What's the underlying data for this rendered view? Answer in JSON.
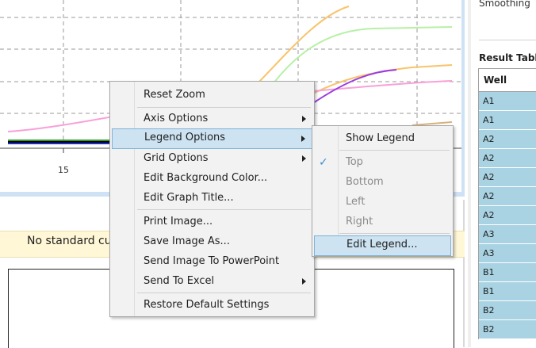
{
  "chart": {
    "x_tick_label": "15",
    "series_colors": [
      "#f9c36a",
      "#b7f0a6",
      "#9b3be0",
      "#f8a0d8",
      "#000000",
      "#1a2bd6",
      "#2aa02a",
      "#d9b07a"
    ]
  },
  "lower_panel": {
    "message": "No standard cu"
  },
  "right_pane": {
    "smoothing_label": "Smoothing",
    "result_table_title": "Result Table",
    "table_header": "Well",
    "rows": [
      "A1",
      "A1",
      "A2",
      "A2",
      "A2",
      "A2",
      "A2",
      "A3",
      "A3",
      "B1",
      "B1",
      "B2",
      "B2"
    ]
  },
  "context_menu": {
    "items": [
      {
        "label": "Reset Zoom"
      },
      {
        "label": "Axis Options"
      },
      {
        "label": "Legend Options"
      },
      {
        "label": "Grid Options"
      },
      {
        "label": "Edit Background Color..."
      },
      {
        "label": "Edit Graph Title..."
      },
      {
        "label": "Print Image..."
      },
      {
        "label": "Save Image As..."
      },
      {
        "label": "Send Image To PowerPoint"
      },
      {
        "label": "Send To Excel"
      },
      {
        "label": "Restore Default Settings"
      }
    ],
    "highlighted": "Legend Options"
  },
  "legend_submenu": {
    "items": [
      {
        "label": "Show Legend"
      },
      {
        "label": "Top"
      },
      {
        "label": "Bottom"
      },
      {
        "label": "Left"
      },
      {
        "label": "Right"
      },
      {
        "label": "Edit Legend..."
      }
    ],
    "checked": "Top",
    "highlighted": "Edit Legend...",
    "check_icon": "✓"
  }
}
